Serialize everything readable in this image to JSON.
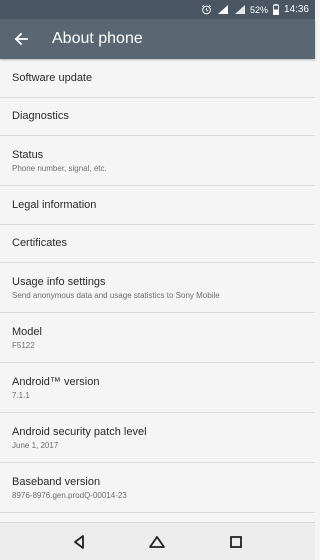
{
  "status_bar": {
    "battery_percent": "52%",
    "time": "14:36",
    "icons": [
      "alarm-icon",
      "signal-icon",
      "wifi-icon",
      "battery-icon"
    ]
  },
  "app_bar": {
    "title": "About phone",
    "back_icon": "arrow-back-icon"
  },
  "items": [
    {
      "title": "Software update",
      "summary": ""
    },
    {
      "title": "Diagnostics",
      "summary": ""
    },
    {
      "title": "Status",
      "summary": "Phone number, signal, etc."
    },
    {
      "title": "Legal information",
      "summary": ""
    },
    {
      "title": "Certificates",
      "summary": ""
    },
    {
      "title": "Usage info settings",
      "summary": "Send anonymous data and usage statistics to Sony Mobile"
    },
    {
      "title": "Model",
      "summary": "F5122"
    },
    {
      "title": "Android™ version",
      "summary": "7.1.1"
    },
    {
      "title": "Android security patch level",
      "summary": "June 1, 2017"
    },
    {
      "title": "Baseband version",
      "summary": "8976-8976.gen.prodQ-00014-23"
    }
  ],
  "nav_bar": {
    "icons": [
      "back-triangle-icon",
      "home-icon",
      "recents-icon"
    ]
  },
  "colors": {
    "status_bar": "#4a5663",
    "app_bar": "#5a6773",
    "background": "#f5f5f5",
    "divider": "#dcdcdc"
  }
}
